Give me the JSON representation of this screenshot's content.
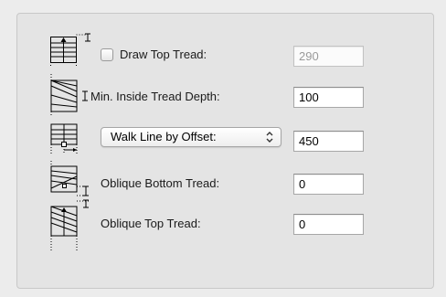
{
  "rows": {
    "draw_top_tread": {
      "label": "Draw Top Tread:",
      "checked": false,
      "value": "290",
      "enabled": false
    },
    "min_inside_tread_depth": {
      "label": "Min. Inside Tread Depth:",
      "value": "100"
    },
    "walk_line": {
      "selected": "Walk Line by Offset:",
      "value": "450"
    },
    "oblique_bottom_tread": {
      "label": "Oblique Bottom Tread:",
      "value": "0"
    },
    "oblique_top_tread": {
      "label": "Oblique Top Tread:",
      "value": "0"
    }
  },
  "icons": {
    "row1": "stair-top-tread-icon",
    "row2": "stair-inside-tread-depth-icon",
    "row3": "stair-walk-line-icon",
    "row4": "stair-oblique-bottom-tread-icon",
    "row5": "stair-oblique-top-tread-icon",
    "dimension": "dimension-marker-icon",
    "popup_arrows": "up-down-chevron-icon"
  }
}
